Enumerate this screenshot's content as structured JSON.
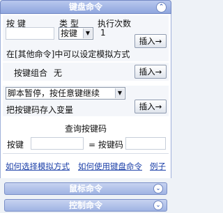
{
  "panel": {
    "title": "键盘命令",
    "collapse_glyph": "⌃"
  },
  "keyboard": {
    "key_label": "按 键",
    "type_label": "类 型",
    "count_label": "执行次数",
    "type_value": "按键",
    "count_value": "1",
    "insert_label": "插入→",
    "hint": "在[其他命令]中可以设定模拟方式"
  },
  "combo": {
    "label": "按键组合",
    "value": "无",
    "insert_label": "插入→"
  },
  "pause": {
    "select_value": "脚本暂停，按任意键继续",
    "store_label": "把按键码存入变量",
    "insert_label": "插入→"
  },
  "query": {
    "title": "查询按键码",
    "key_label": "按键",
    "code_label": "= 按键码"
  },
  "links": {
    "how_choose": "如何选择模拟方式",
    "how_use": "如何使用键盘命令",
    "example": "例子"
  },
  "sections": [
    {
      "label": "鼠标命令",
      "glyph": "⌄"
    },
    {
      "label": "控制命令",
      "glyph": "⌄"
    }
  ]
}
